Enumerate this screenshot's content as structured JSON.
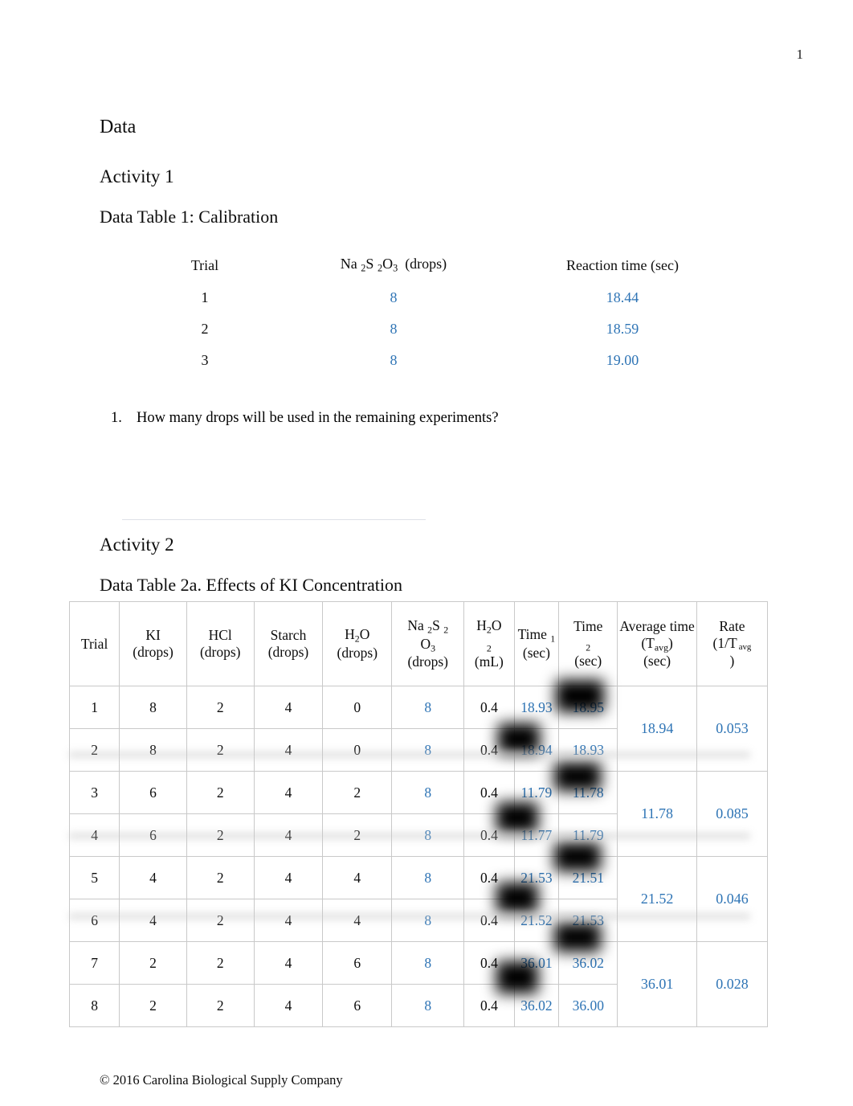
{
  "page": {
    "number": "1",
    "footer": "© 2016 Carolina Biological Supply Company",
    "accent_blue": "#2e74b5",
    "text_color": "#0d0d0d"
  },
  "headings": {
    "data": "Data",
    "activity1": "Activity 1",
    "table1_title": "Data Table 1: Calibration",
    "activity2": "Activity 2",
    "table2_title": "Data Table 2a. Effects of KI Concentration"
  },
  "calibration_table": {
    "headers": {
      "trial": "Trial",
      "thiosulfate": "Na 2S 2O 3  (drops)",
      "thiosulfate_parts": {
        "na": "Na",
        "sub1": "2",
        "s": "S",
        "sub2": "2",
        "o": "O",
        "sub3": "3",
        "unit": "(drops)"
      },
      "reaction_time": "Reaction time (sec)"
    },
    "rows": [
      {
        "trial": "1",
        "drops": "8",
        "time": "18.44"
      },
      {
        "trial": "2",
        "drops": "8",
        "time": "18.59"
      },
      {
        "trial": "3",
        "drops": "8",
        "time": "19.00"
      }
    ]
  },
  "question1": {
    "number": "1.",
    "text": "How many drops will be used in the remaining experiments?"
  },
  "main_table": {
    "headers": {
      "trial": "Trial",
      "ki": "KI (drops)",
      "hcl": "HCl (drops)",
      "starch": "Starch (drops)",
      "water": "H 2O (drops)",
      "thiosulfate": "Na 2S 2O 3 (drops)",
      "peroxide": "H 2O 2 (mL)",
      "time1": "Time 1 (sec)",
      "time2": "Time 2 (sec)",
      "avg": "Average time (T avg ) (sec)",
      "rate": "Rate (1/T avg )",
      "parts": {
        "trial": "Trial",
        "ki_name": "KI",
        "ki_unit": "(drops)",
        "hcl_name": "HCl",
        "hcl_unit": "(drops)",
        "starch_name": "Starch",
        "starch_unit": "(drops)",
        "water_name": "H",
        "water_sub": "2",
        "water_name2": "O",
        "water_unit": "(drops)",
        "na": "Na",
        "na_sub1": "2",
        "na_s": "S",
        "na_sub2": "2",
        "na_o": "O",
        "na_sub3": "3",
        "na_unit": "(drops)",
        "per_h": "H",
        "per_sub1": "2",
        "per_o": "O",
        "per_sub2": "2",
        "per_unit": "(mL)",
        "time_word": "Time",
        "time1_sub": "1",
        "time2_sub": "2",
        "time_unit": "(sec)",
        "avg_word": "Average time",
        "avg_t": "(T",
        "avg_sub": "avg",
        "avg_close": ")",
        "avg_unit": "(sec)",
        "rate_word": "Rate",
        "rate_open": "(1/T",
        "rate_sub": "avg",
        "rate_close": ")"
      }
    },
    "rows": [
      {
        "trial": "1",
        "ki": "8",
        "hcl": "2",
        "starch": "4",
        "water": "0",
        "thio": "8",
        "peroxide": "0.4",
        "time1": "18.93",
        "time2": "18.95"
      },
      {
        "trial": "2",
        "ki": "8",
        "hcl": "2",
        "starch": "4",
        "water": "0",
        "thio": "8",
        "peroxide": "0.4",
        "time1": "18.94",
        "time2": "18.93"
      },
      {
        "trial": "3",
        "ki": "6",
        "hcl": "2",
        "starch": "4",
        "water": "2",
        "thio": "8",
        "peroxide": "0.4",
        "time1": "11.79",
        "time2": "11.78"
      },
      {
        "trial": "4",
        "ki": "6",
        "hcl": "2",
        "starch": "4",
        "water": "2",
        "thio": "8",
        "peroxide": "0.4",
        "time1": "11.77",
        "time2": "11.79"
      },
      {
        "trial": "5",
        "ki": "4",
        "hcl": "2",
        "starch": "4",
        "water": "4",
        "thio": "8",
        "peroxide": "0.4",
        "time1": "21.53",
        "time2": "21.51"
      },
      {
        "trial": "6",
        "ki": "4",
        "hcl": "2",
        "starch": "4",
        "water": "4",
        "thio": "8",
        "peroxide": "0.4",
        "time1": "21.52",
        "time2": "21.53"
      },
      {
        "trial": "7",
        "ki": "2",
        "hcl": "2",
        "starch": "4",
        "water": "6",
        "thio": "8",
        "peroxide": "0.4",
        "time1": "36.01",
        "time2": "36.02"
      },
      {
        "trial": "8",
        "ki": "2",
        "hcl": "2",
        "starch": "4",
        "water": "6",
        "thio": "8",
        "peroxide": "0.4",
        "time1": "36.02",
        "time2": "36.00"
      }
    ],
    "pairs": [
      {
        "avg": "18.94",
        "rate": "0.053"
      },
      {
        "avg": "11.78",
        "rate": "0.085"
      },
      {
        "avg": "21.52",
        "rate": "0.046"
      },
      {
        "avg": "36.01",
        "rate": "0.028"
      }
    ]
  }
}
